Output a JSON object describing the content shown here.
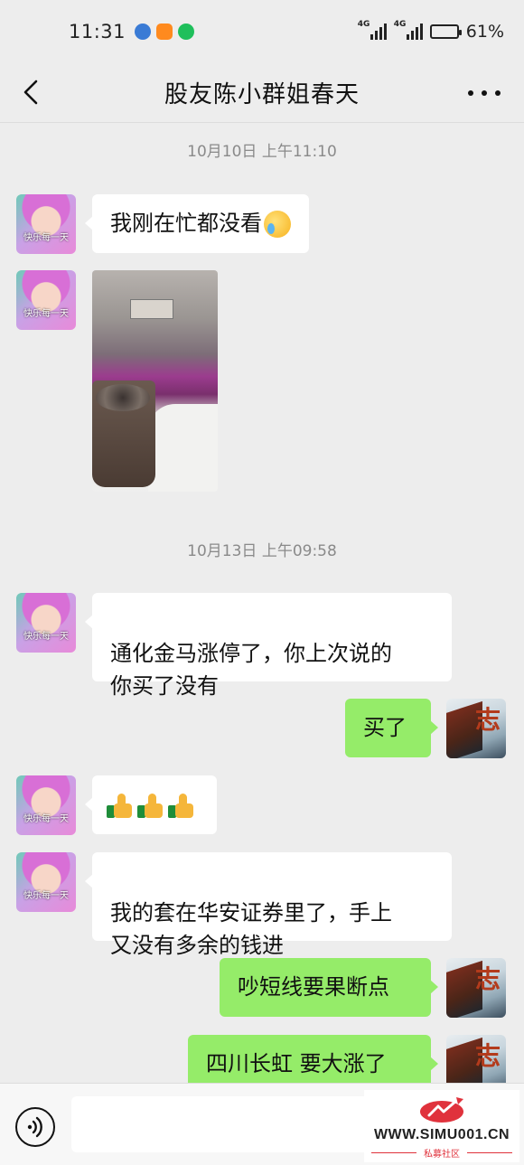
{
  "status_bar": {
    "time": "11:31",
    "network_1": "4G",
    "network_2": "4G",
    "battery": "61%",
    "battery_level": 0.61,
    "app_icon_colors": [
      "#3a7bd5",
      "#ff8a1e",
      "#1fbf5b"
    ]
  },
  "header": {
    "title": "股友陈小群姐春天"
  },
  "friend_avatar_caption": "快乐每一天",
  "my_avatar_glyph": "志",
  "messages": [
    {
      "type": "timestamp",
      "text": "10月10日 上午11:10"
    },
    {
      "type": "text",
      "sender": "friend",
      "text": "我刚在忙都没看",
      "emoji": "crying-face"
    },
    {
      "type": "image",
      "sender": "friend"
    },
    {
      "type": "timestamp",
      "text": "10月13日 上午09:58"
    },
    {
      "type": "text",
      "sender": "friend",
      "text": "通化金马涨停了，你上次说的\n你买了没有"
    },
    {
      "type": "text",
      "sender": "me",
      "text": "买了"
    },
    {
      "type": "emoji",
      "sender": "friend",
      "emoji": "thumbs-up x3"
    },
    {
      "type": "text",
      "sender": "friend",
      "text": "我的套在华安证券里了，手上\n又没有多余的钱进"
    },
    {
      "type": "text",
      "sender": "me",
      "text": "吵短线要果断点"
    },
    {
      "type": "text",
      "sender": "me",
      "text": "四川长虹 要大涨了"
    }
  ],
  "colors": {
    "background": "#ededed",
    "my_bubble": "#95ec69",
    "friend_bubble": "#ffffff"
  },
  "watermark": {
    "url": "WWW.SIMU001.CN",
    "subtitle": "私募社区"
  }
}
